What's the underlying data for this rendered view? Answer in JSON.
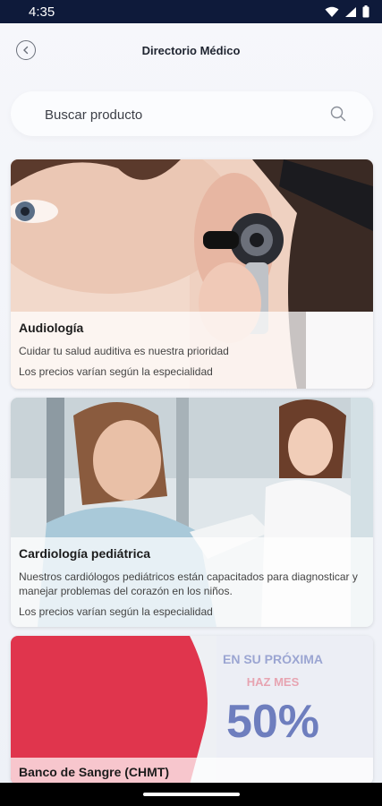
{
  "status_bar": {
    "time": "4:35"
  },
  "header": {
    "title": "Directorio Médico"
  },
  "search": {
    "placeholder": "Buscar producto",
    "value": ""
  },
  "cards": [
    {
      "title": "Audiología",
      "description": "Cuidar tu salud auditiva es nuestra prioridad",
      "price_note": "Los precios varían según la especialidad"
    },
    {
      "title": "Cardiología pediátrica",
      "description": "Nuestros cardiólogos pediátricos están capacitados para diagnosticar y manejar problemas del corazón en los niños.",
      "price_note": "Los precios varían según la especialidad"
    },
    {
      "title": "Banco de Sangre (CHMT)",
      "banner_lines": [
        "EN SU PRÓXIMA",
        "HAZ MES",
        "50%"
      ]
    }
  ],
  "colors": {
    "status_bar": "#0e1a3a",
    "background": "#f0f2f7",
    "accent_red": "#e0354d",
    "banner_blue": "#3a4fa8"
  },
  "icons": [
    "wifi-icon",
    "signal-icon",
    "battery-icon",
    "back-icon",
    "search-icon"
  ]
}
